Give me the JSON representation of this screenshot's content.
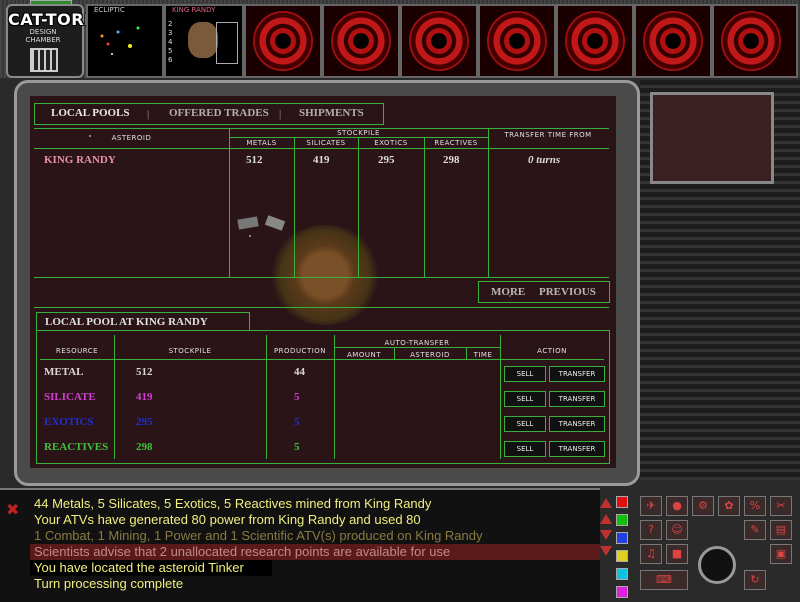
{
  "watermark": "CAT-TORRENT.ORG",
  "top": {
    "design_label": "DESIGN CHAMBER",
    "minimap_title": "ECLIPTIC",
    "asteroid_title": "KING RANDY",
    "asteroid_numbers": [
      "2",
      "3",
      "4",
      "5",
      "6"
    ]
  },
  "tabs": {
    "local_pools": "LOCAL POOLS",
    "offered_trades": "OFFERED TRADES",
    "shipments": "SHIPMENTS"
  },
  "pools_table": {
    "headers": {
      "asteroid": "ASTEROID",
      "stockpile": "STOCKPILE",
      "metals": "METALS",
      "silicates": "SILICATES",
      "exotics": "EXOTICS",
      "reactives": "REACTIVES",
      "transfer_time": "TRANSFER TIME FROM"
    },
    "rows": [
      {
        "asteroid": "KING RANDY",
        "metals": "512",
        "silicates": "419",
        "exotics": "295",
        "reactives": "298",
        "transfer": "0 turns"
      }
    ]
  },
  "paging": {
    "more": "MORE",
    "previous": "PREVIOUS"
  },
  "local_pool": {
    "title": "LOCAL POOL AT KING RANDY",
    "headers": {
      "resource": "RESOURCE",
      "stockpile": "STOCKPILE",
      "production": "PRODUCTION",
      "auto_transfer": "AUTO-TRANSFER",
      "amount": "AMOUNT",
      "asteroid": "ASTEROID",
      "time": "TIME",
      "action": "ACTION"
    },
    "rows": [
      {
        "name": "METAL",
        "stock": "512",
        "prod": "44",
        "color": "#d8d8d8"
      },
      {
        "name": "SILICATE",
        "stock": "419",
        "prod": "5",
        "color": "#d040d0"
      },
      {
        "name": "EXOTICS",
        "stock": "295",
        "prod": "5",
        "color": "#2030d0"
      },
      {
        "name": "REACTIVES",
        "stock": "298",
        "prod": "5",
        "color": "#40c040"
      }
    ],
    "sell_label": "SELL",
    "transfer_label": "TRANSFER"
  },
  "messages": [
    {
      "text": "44 Metals, 5 Silicates, 5 Exotics, 5 Reactives mined from King Randy",
      "color": "#f0f080"
    },
    {
      "text": "Your ATVs have generated 80 power from King Randy and used 80",
      "color": "#f0f080"
    },
    {
      "text": "1 Combat, 1 Mining, 1 Power and 1 Scientific ATV(s) produced on King Randy",
      "color": "#8a7a40"
    },
    {
      "text": "Scientists advise that 2 unallocated research points are available for use",
      "color": "#c08a8a"
    },
    {
      "text": "You have located the asteroid Tinker",
      "color": "#f0f080"
    },
    {
      "text": "Turn processing complete",
      "color": "#f0f080"
    }
  ],
  "colors": {
    "accent_green": "#3ab03a",
    "indicator_swatches": [
      "#e01010",
      "#10c010",
      "#2040e0",
      "#e0d020",
      "#10c0e0",
      "#e020e0"
    ]
  },
  "icons": [
    "close-icon",
    "scroll-up-icon",
    "scroll-down-icon",
    "rose-icon",
    "planet-icon",
    "ship-icon",
    "gear-icon",
    "music-icon",
    "book-icon",
    "disk-icon",
    "keyboard-icon",
    "refresh-icon"
  ]
}
